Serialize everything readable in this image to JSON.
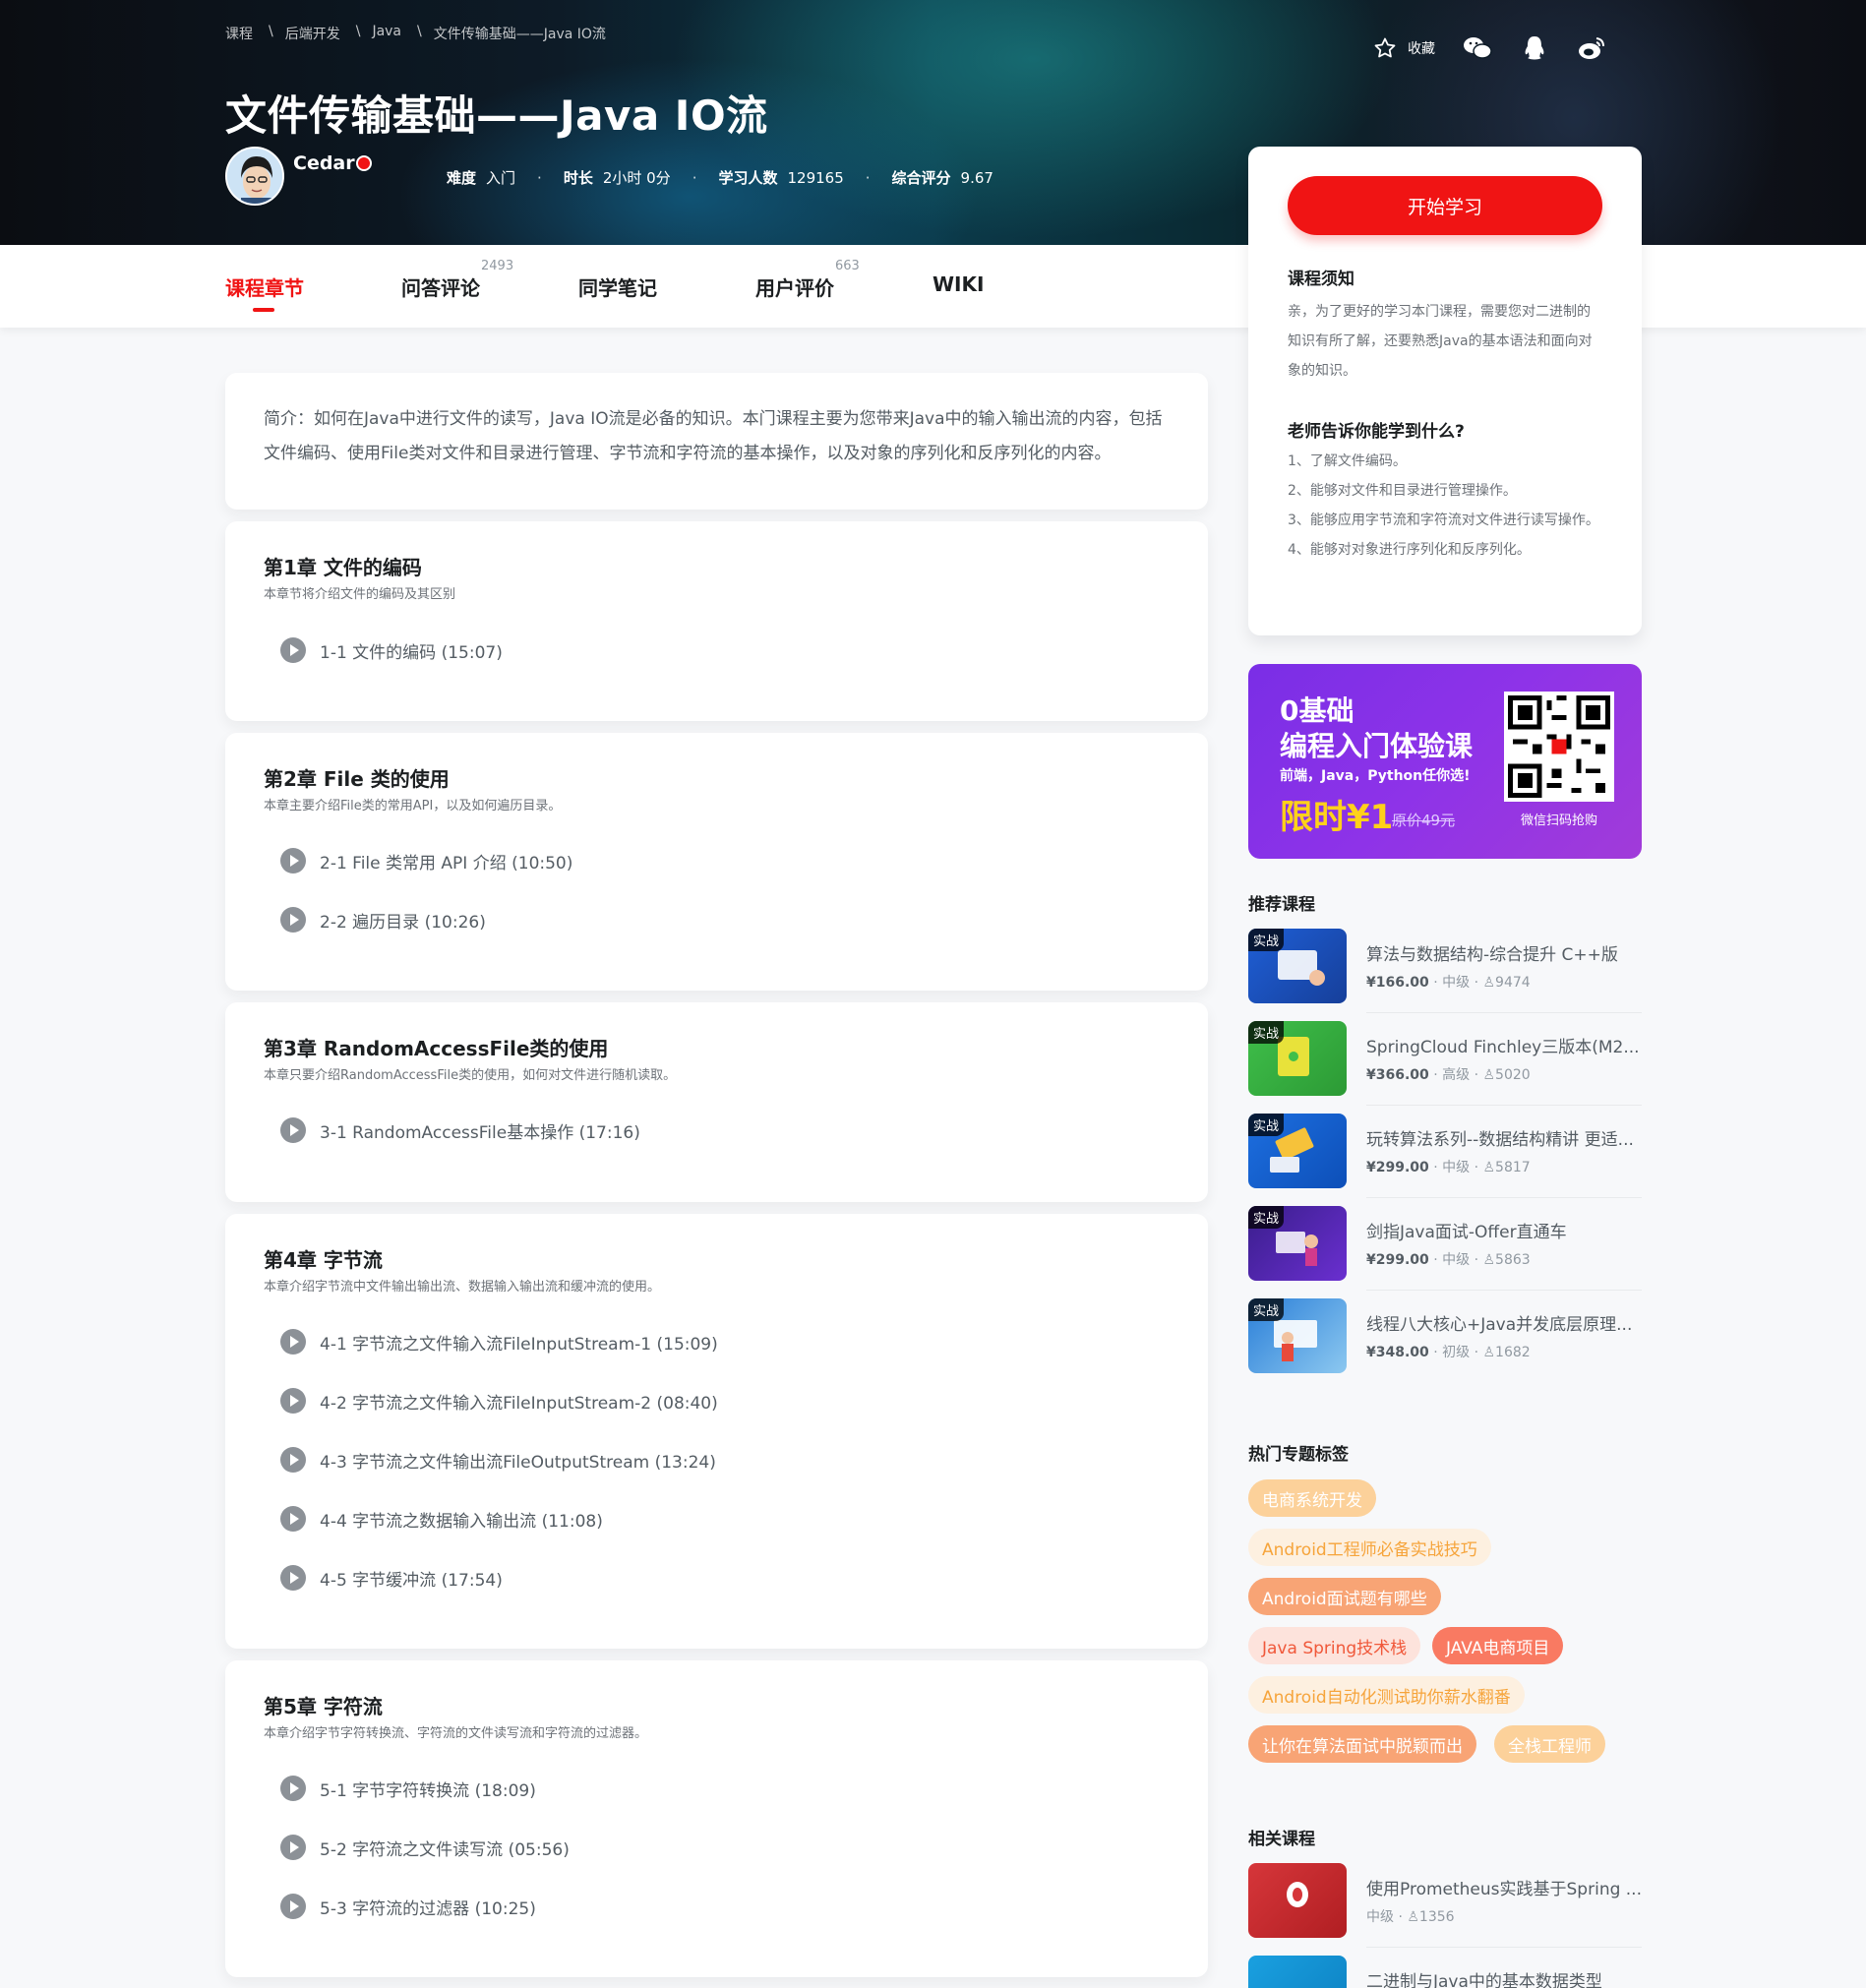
{
  "breadcrumb": [
    "课程",
    "后端开发",
    "Java",
    "文件传输基础——Java IO流"
  ],
  "breadcrumb_sep": "\\",
  "course": {
    "title": "文件传输基础——Java IO流",
    "teacher": "Cedar",
    "meta": [
      {
        "k": "难度",
        "v": "入门"
      },
      {
        "k": "时长",
        "v": "2小时 0分"
      },
      {
        "k": "学习人数",
        "v": "129165"
      },
      {
        "k": "综合评分",
        "v": "9.67"
      }
    ],
    "meta_dot": "·"
  },
  "actions": {
    "fav_label": "收藏",
    "icons": [
      "star-icon",
      "wechat-icon",
      "qq-icon",
      "weibo-icon"
    ]
  },
  "tabs": [
    {
      "label": "课程章节",
      "count": ""
    },
    {
      "label": "问答评论",
      "count": "2493"
    },
    {
      "label": "同学笔记",
      "count": ""
    },
    {
      "label": "用户评价",
      "count": "663"
    },
    {
      "label": "WIKI",
      "count": ""
    }
  ],
  "intro": "简介：如何在Java中进行文件的读写，Java IO流是必备的知识。本门课程主要为您带来Java中的输入输出流的内容，包括文件编码、使用File类对文件和目录进行管理、字节流和字符流的基本操作，以及对象的序列化和反序列化的内容。",
  "chapters": [
    {
      "title": "第1章 文件的编码",
      "desc": "本章节将介绍文件的编码及其区别",
      "lessons": [
        "1-1 文件的编码 (15:07)"
      ]
    },
    {
      "title": "第2章 File 类的使用",
      "desc": "本章主要介绍File类的常用API，以及如何遍历目录。",
      "lessons": [
        "2-1 File 类常用 API 介绍 (10:50)",
        "2-2 遍历目录 (10:26)"
      ]
    },
    {
      "title": "第3章 RandomAccessFile类的使用",
      "desc": "本章只要介绍RandomAccessFile类的使用，如何对文件进行随机读取。",
      "lessons": [
        "3-1 RandomAccessFile基本操作 (17:16)"
      ]
    },
    {
      "title": "第4章 字节流",
      "desc": "本章介绍字节流中文件输出输出流、数据输入输出流和缓冲流的使用。",
      "lessons": [
        "4-1 字节流之文件输入流FileInputStream-1 (15:09)",
        "4-2 字节流之文件输入流FileInputStream-2 (08:40)",
        "4-3 字节流之文件输出流FileOutputStream (13:24)",
        "4-4 字节流之数据输入输出流 (11:08)",
        "4-5 字节缓冲流 (17:54)"
      ]
    },
    {
      "title": "第5章 字符流",
      "desc": "本章介绍字节字符转换流、字符流的文件读写流和字符流的过滤器。",
      "lessons": [
        "5-1 字节字符转换流 (18:09)",
        "5-2 字符流之文件读写流 (05:56)",
        "5-3 字符流的过滤器 (10:25)"
      ]
    }
  ],
  "sidebar": {
    "start_label": "开始学习",
    "notice_title": "课程须知",
    "notice_text": "亲，为了更好的学习本门课程，需要您对二进制的知识有所了解，还要熟悉Java的基本语法和面向对象的知识。",
    "learn_title": "老师告诉你能学到什么?",
    "learn_items": [
      "1、了解文件编码。",
      "2、能够对文件和目录进行管理操作。",
      "3、能够应用字节流和字符流对文件进行读写操作。",
      "4、能够对对象进行序列化和反序列化。"
    ]
  },
  "promo": {
    "line1": "0基础",
    "line2": "编程入门体验课",
    "line3": "前端，Java，Python任你选!",
    "price": "限时¥1",
    "orig": "原价49元",
    "qr_caption": "微信扫码抢购"
  },
  "recommend": {
    "title": "推荐课程",
    "items": [
      {
        "tag": "实战",
        "name": "算法与数据结构-综合提升 C++版",
        "price": "¥166.00",
        "level": "中级",
        "students": "9474",
        "color": "#1f5fd6"
      },
      {
        "tag": "实战",
        "name": "SpringCloud Finchley三版本(M2...",
        "price": "¥366.00",
        "level": "高级",
        "students": "5020",
        "color": "#3fbf4a"
      },
      {
        "tag": "实战",
        "name": "玩转算法系列--数据结构精讲 更适...",
        "price": "¥299.00",
        "level": "中级",
        "students": "5817",
        "color": "#1d6fe0"
      },
      {
        "tag": "实战",
        "name": "剑指Java面试-Offer直通车",
        "price": "¥299.00",
        "level": "中级",
        "students": "5863",
        "color": "#3a1e8c"
      },
      {
        "tag": "实战",
        "name": "线程八大核心+Java并发底层原理...",
        "price": "¥348.00",
        "level": "初级",
        "students": "1682",
        "color": "#2b7fd8"
      }
    ]
  },
  "hot_tags": {
    "title": "热门专题标签",
    "items": [
      "电商系统开发",
      "Android工程师必备实战技巧",
      "Android面试题有哪些",
      "Java Spring技术栈",
      "JAVA电商项目",
      "Android自动化测试助你薪水翻番",
      "让你在算法面试中脱颖而出",
      "全栈工程师"
    ]
  },
  "related": {
    "title": "相关课程",
    "items": [
      {
        "name": "使用Prometheus实践基于Spring ...",
        "level": "中级",
        "students": "1356",
        "color": "#d6363a"
      },
      {
        "name": "二进制与Java中的基本数据类型",
        "level": "",
        "students": "",
        "color": "#1aa0e0"
      }
    ]
  },
  "colors": {
    "accent": "#f01414",
    "tag_orange": "#f6a43b",
    "tag_light": "#fdf0e0"
  }
}
